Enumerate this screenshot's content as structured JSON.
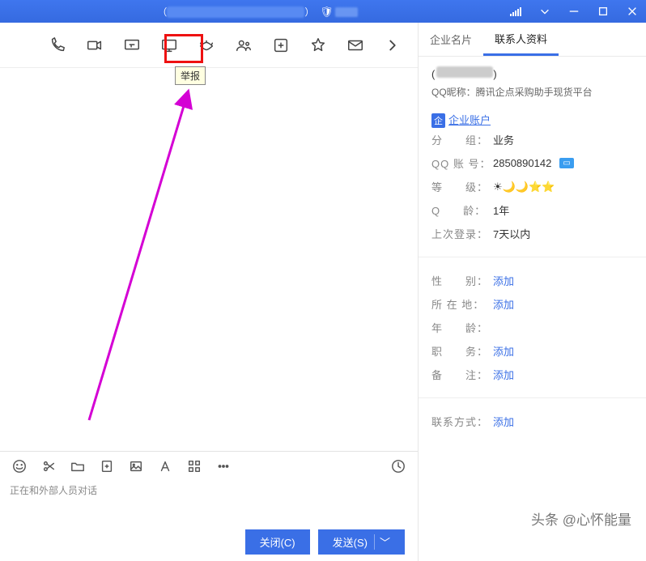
{
  "titlebar": {
    "left_paren": "（",
    "right_paren": "）",
    "signal_bars": 5
  },
  "toolbar": {
    "tooltip_report": "举报"
  },
  "status_line": "正在和外部人员对话",
  "footer": {
    "close_label": "关闭(C)",
    "send_label": "发送(S)"
  },
  "right_panel": {
    "tabs": {
      "biz_card": "企业名片",
      "contact_info": "联系人资料"
    },
    "display_paren_left": "(",
    "display_paren_right": ")",
    "nick_label": "QQ昵称：",
    "nick_value": "腾讯企点采购助手现货平台",
    "enterprise_badge": "企",
    "enterprise_link": "企业账户",
    "rows": {
      "group_label": "分　　组：",
      "group_value": "业务",
      "qq_label": "QQ 账 号：",
      "qq_value": "2850890142",
      "level_label": "等　　级：",
      "level_icons": "☀🌙🌙⭐⭐",
      "qage_label": "Q　　龄：",
      "qage_value": "1年",
      "last_login_label": "上次登录：",
      "last_login_value": "7天以内",
      "gender_label": "性　　别：",
      "gender_value": "添加",
      "location_label": "所 在 地：",
      "location_value": "添加",
      "age_label": "年　　龄：",
      "age_value": "",
      "job_label": "职　　务：",
      "job_value": "添加",
      "remark_label": "备　　注：",
      "remark_value": "添加",
      "contact_label": "联系方式：",
      "contact_value": "添加"
    }
  },
  "watermark": "头条 @心怀能量"
}
